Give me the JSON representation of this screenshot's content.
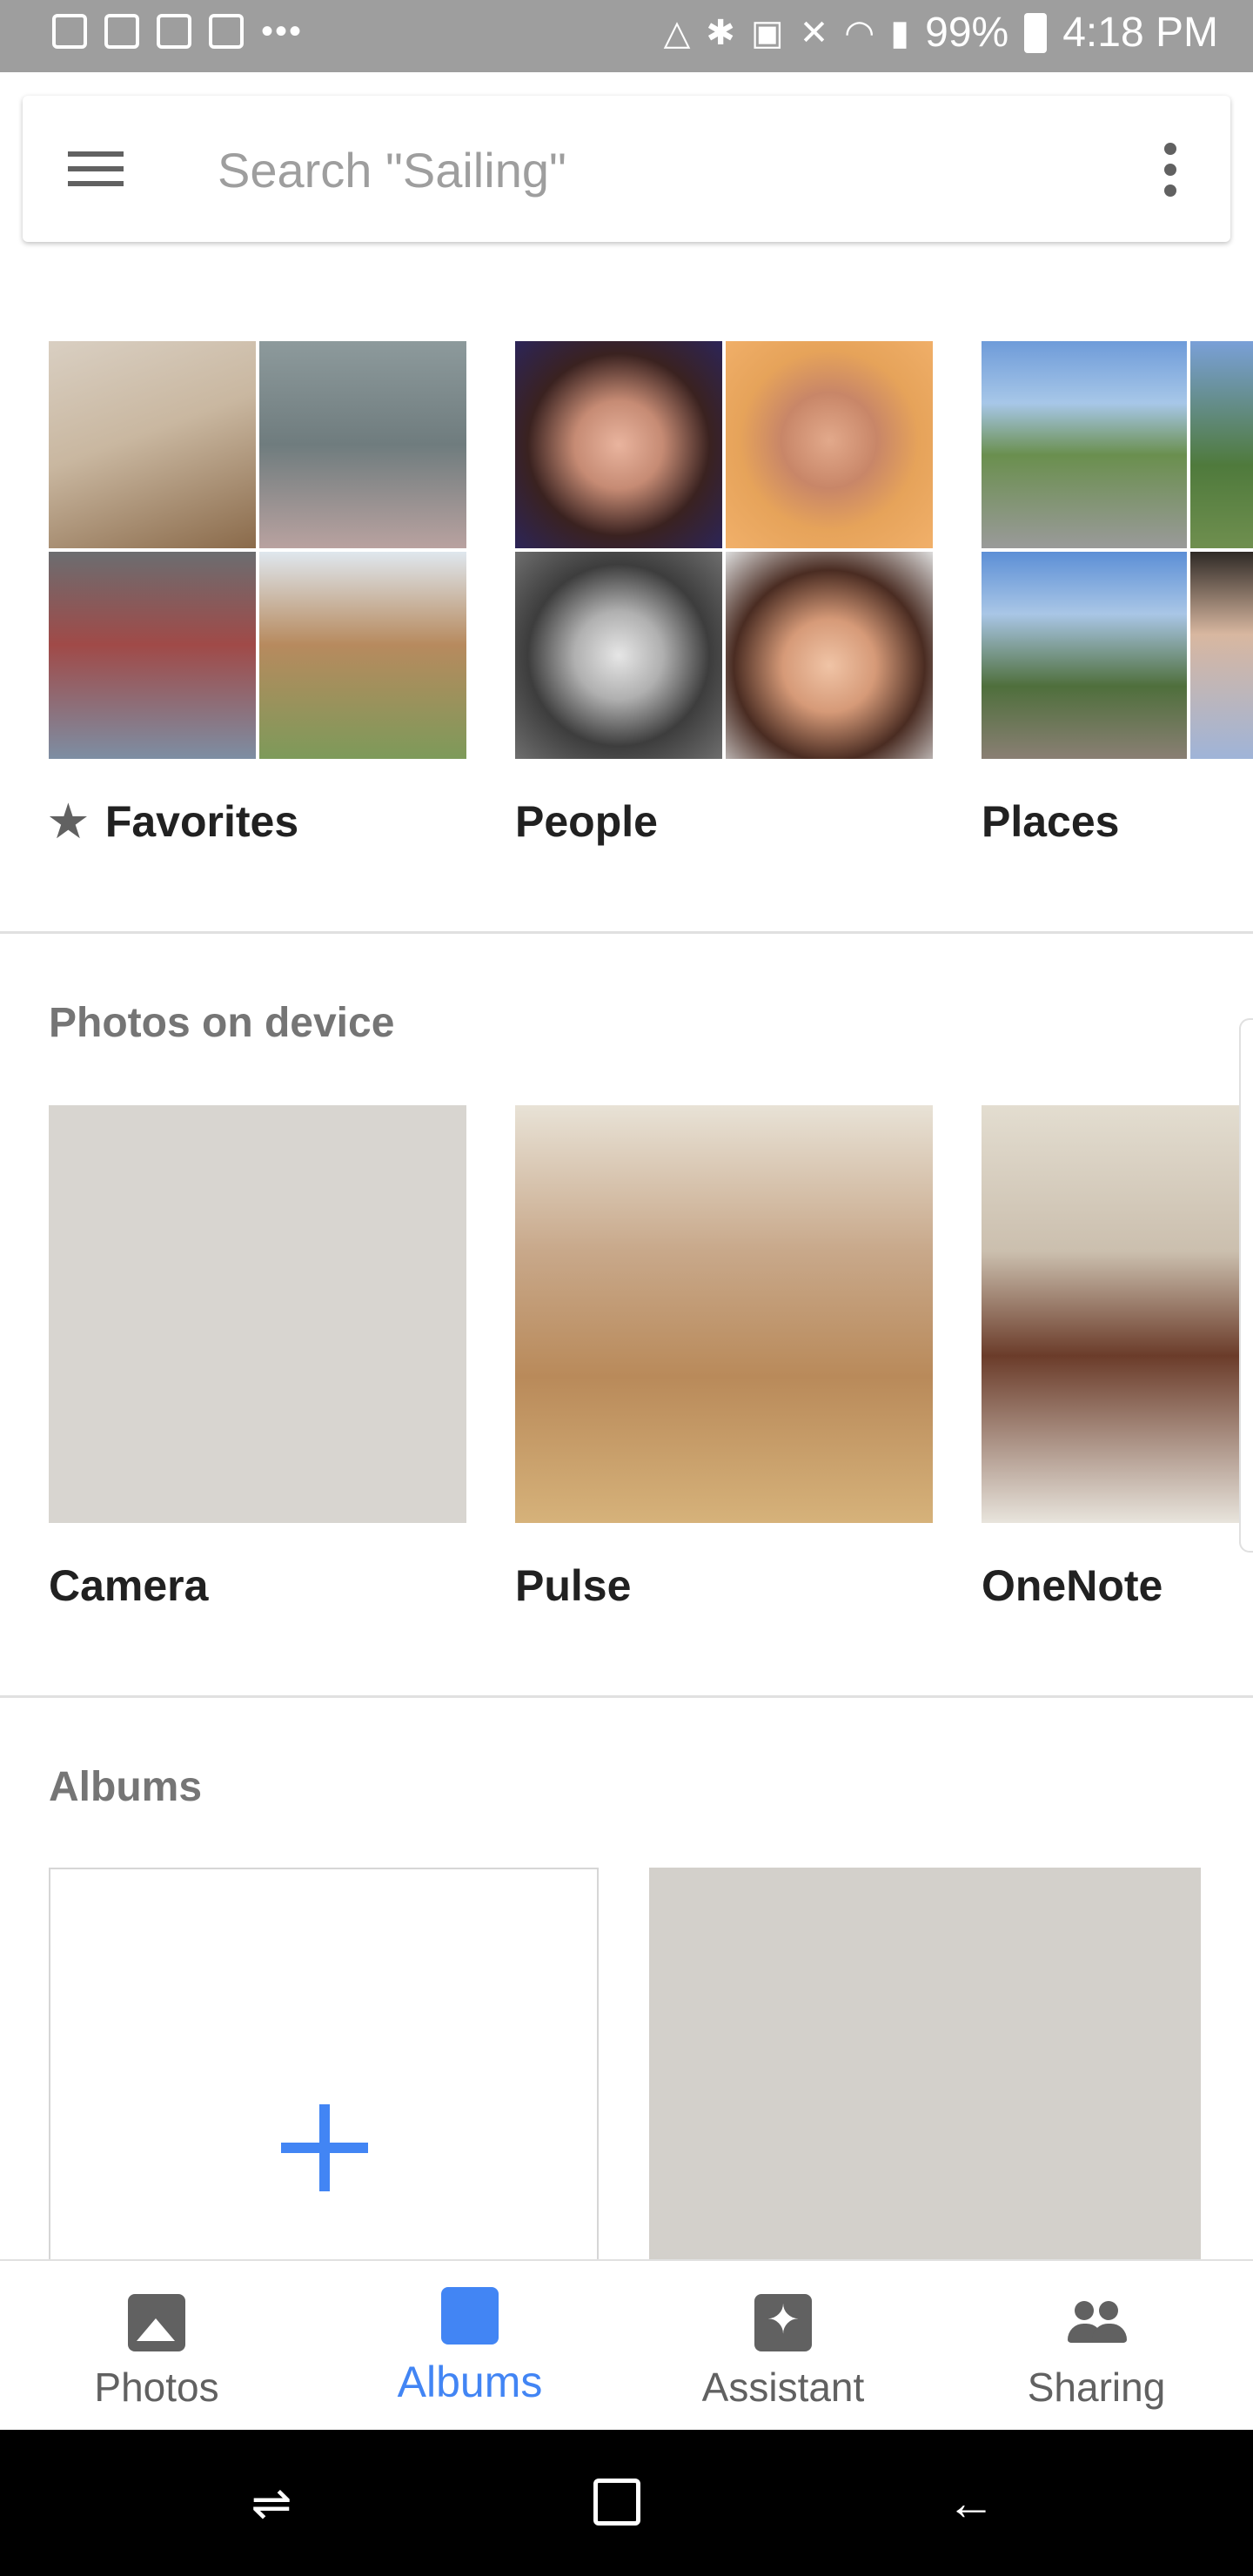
{
  "status_bar": {
    "battery": "99%",
    "time": "4:18 PM",
    "overflow": "•••"
  },
  "search": {
    "placeholder": "Search \"Sailing\""
  },
  "top_collections": [
    {
      "label": "Favorites",
      "icon": "star-icon"
    },
    {
      "label": "People",
      "icon": ""
    },
    {
      "label": "Places",
      "icon": ""
    }
  ],
  "photos_on_device": {
    "title": "Photos on device",
    "folders": [
      {
        "label": "Camera"
      },
      {
        "label": "Pulse"
      },
      {
        "label": "OneNote"
      }
    ]
  },
  "albums": {
    "title": "Albums"
  },
  "bottom_nav": {
    "items": [
      {
        "label": "Photos",
        "icon": "photos-icon",
        "active": false
      },
      {
        "label": "Albums",
        "icon": "albums-icon",
        "active": true
      },
      {
        "label": "Assistant",
        "icon": "assistant-icon",
        "active": false
      },
      {
        "label": "Sharing",
        "icon": "sharing-icon",
        "active": false
      }
    ]
  },
  "colors": {
    "accent": "#4285f4",
    "status_bar": "#9e9e9e",
    "section_title": "#757575"
  }
}
